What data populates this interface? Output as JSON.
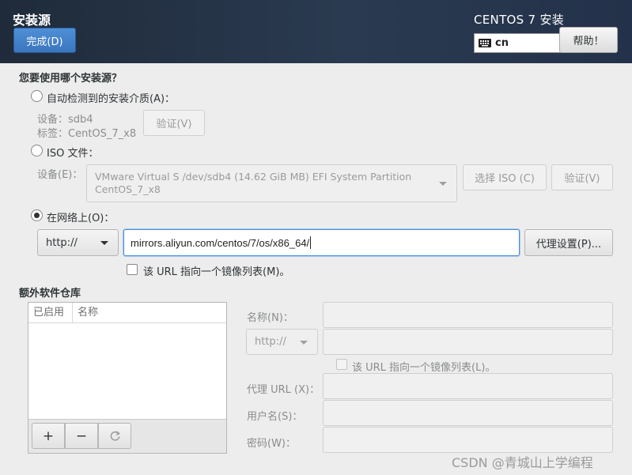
{
  "header": {
    "title": "安装源",
    "done_button": "完成(D)",
    "product": "CENTOS 7 安装",
    "keyboard_layout": "cn",
    "help_button": "帮助！"
  },
  "question": "您要使用哪个安装源？",
  "auto_detect": {
    "label": "自动检测到的安装介质(A)：",
    "selected": false,
    "device_line": "设备：sdb4",
    "label_line": "标签：CentOS_7_x8",
    "verify_button": "验证(V)"
  },
  "iso": {
    "label": "ISO 文件：",
    "selected": false,
    "device_label": "设备(E)：",
    "device_value_line1": "VMware Virtual S /dev/sdb4 (14.62 GiB MB) EFI System Partition",
    "device_value_line2": "CentOS_7_x8",
    "choose_button": "选择 ISO (C)",
    "verify_button": "验证(V)"
  },
  "network": {
    "label": "在网络上(O)：",
    "selected": true,
    "protocol": "http://",
    "url": "mirrors.aliyun.com/centos/7/os/x86_64/",
    "proxy_button": "代理设置(P)...",
    "mirrorlist_label": "该 URL 指向一个镜像列表(M)。",
    "mirrorlist_checked": false
  },
  "extra_repos": {
    "heading": "额外软件仓库",
    "columns": [
      "已启用",
      "名称"
    ],
    "rows": [],
    "add_button": "+",
    "remove_button": "−",
    "name_label": "名称(N)：",
    "protocol": "http://",
    "mirrorlist_label": "该 URL 指向一个镜像列表(L)。",
    "proxy_url_label": "代理 URL (X)：",
    "username_label": "用户名(S)：",
    "password_label": "密码(W)："
  },
  "watermark": "CSDN @青城山上学编程",
  "icons": [
    "keyboard-icon",
    "refresh-icon",
    "chevron-down-icon"
  ],
  "colors": {
    "header_bg": "#2a3a50",
    "done_button": "#3a76bd",
    "page_bg": "#ededed"
  }
}
